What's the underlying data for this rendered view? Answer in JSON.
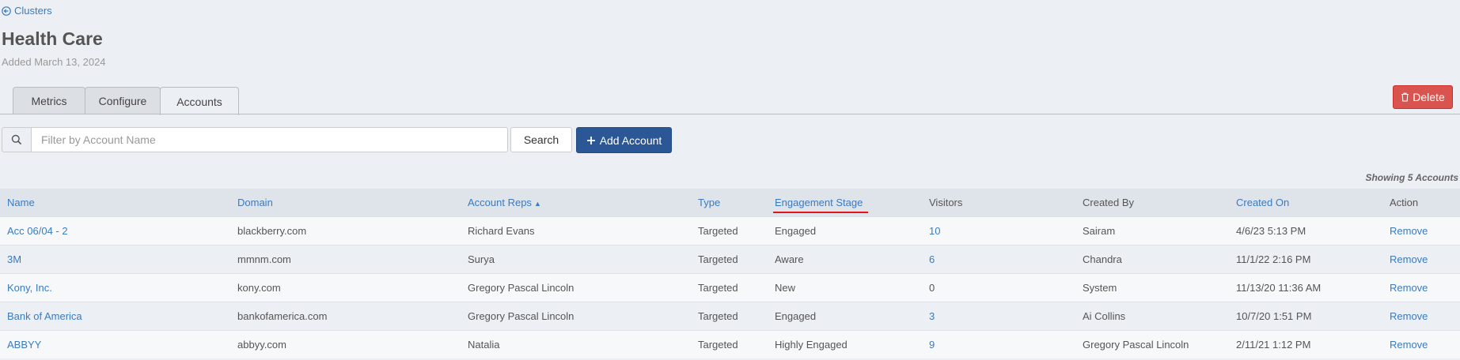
{
  "nav": {
    "back_label": "Clusters"
  },
  "cluster": {
    "title": "Health Care",
    "added": "Added March 13, 2024"
  },
  "tabs": [
    {
      "label": "Metrics"
    },
    {
      "label": "Configure"
    },
    {
      "label": "Accounts"
    }
  ],
  "actions": {
    "delete_label": "Delete"
  },
  "search": {
    "placeholder": "Filter by Account Name",
    "value": "",
    "button_label": "Search",
    "add_label": "Add Account"
  },
  "summary": {
    "showing": "Showing 5 Accounts"
  },
  "table": {
    "columns": [
      "Name",
      "Domain",
      "Account Reps",
      "Type",
      "Engagement Stage",
      "Visitors",
      "Created By",
      "Created On",
      "Action"
    ],
    "sorted_column": "Account Reps",
    "sort_direction": "ascending",
    "rows": [
      {
        "name": "Acc 06/04 - 2",
        "domain": "blackberry.com",
        "reps": "Richard Evans",
        "type": "Targeted",
        "stage": "Engaged",
        "visitors": "10",
        "created_by": "Sairam",
        "created_on": "4/6/23 5:13 PM",
        "action": "Remove"
      },
      {
        "name": "3M",
        "domain": "mmnm.com",
        "reps": "Surya",
        "type": "Targeted",
        "stage": "Aware",
        "visitors": "6",
        "created_by": "Chandra",
        "created_on": "11/1/22 2:16 PM",
        "action": "Remove"
      },
      {
        "name": "Kony, Inc.",
        "domain": "kony.com",
        "reps": "Gregory Pascal Lincoln",
        "type": "Targeted",
        "stage": "New",
        "visitors": "0",
        "created_by": "System",
        "created_on": "11/13/20 11:36 AM",
        "action": "Remove"
      },
      {
        "name": "Bank of America",
        "domain": "bankofamerica.com",
        "reps": "Gregory Pascal Lincoln",
        "type": "Targeted",
        "stage": "Engaged",
        "visitors": "3",
        "created_by": "Ai Collins",
        "created_on": "10/7/20 1:51 PM",
        "action": "Remove"
      },
      {
        "name": "ABBYY",
        "domain": "abbyy.com",
        "reps": "Natalia",
        "type": "Targeted",
        "stage": "Highly Engaged",
        "visitors": "9",
        "created_by": "Gregory Pascal Lincoln",
        "created_on": "2/11/21 1:12 PM",
        "action": "Remove"
      }
    ]
  },
  "icons": {
    "back": "arrow-circle-left-icon",
    "delete": "trash-icon",
    "search": "search-icon",
    "add": "plus-icon",
    "sort": "caret-up-icon"
  },
  "colors": {
    "link": "#3a7bbf",
    "primary": "#2b5797",
    "danger": "#d9534f",
    "annotation": "#e0151c",
    "background": "#eceff4"
  }
}
